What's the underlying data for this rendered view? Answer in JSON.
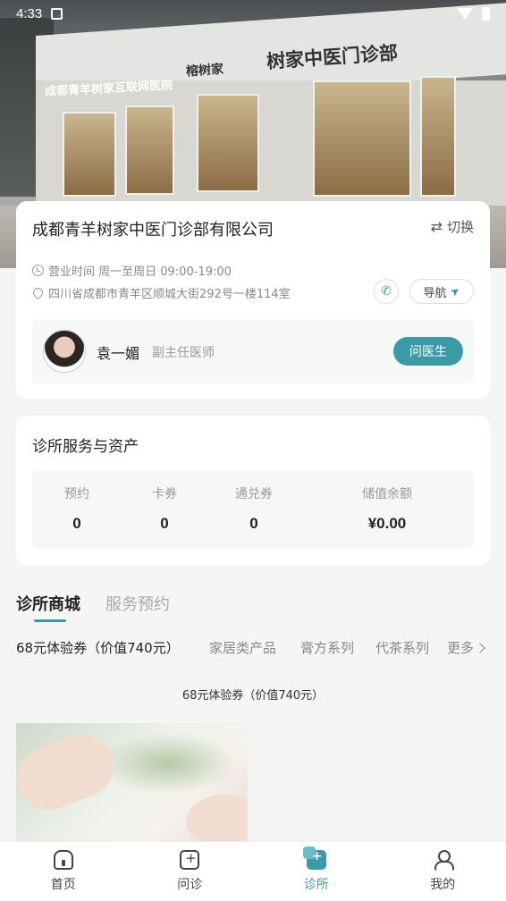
{
  "status_bar": {
    "time": "4:33"
  },
  "hero": {
    "signs": [
      "成都青羊树家互联网医院",
      "树家中医门诊部",
      "榕树家"
    ]
  },
  "clinic": {
    "name": "成都青羊树家中医门诊部有限公司",
    "switch_label": "切换",
    "hours": "营业时间 周一至周日 09:00-19:00",
    "address": "四川省成都市青羊区顺城大街292号一楼114室",
    "nav_label": "导航",
    "doctor": {
      "name": "袁一媚",
      "title": "副主任医师",
      "ask_label": "问医生"
    }
  },
  "assets": {
    "title": "诊所服务与资产",
    "items": [
      {
        "label": "预约",
        "value": "0"
      },
      {
        "label": "卡券",
        "value": "0"
      },
      {
        "label": "通兑券",
        "value": "0"
      },
      {
        "label": "储值余额",
        "value": "¥0.00"
      }
    ]
  },
  "tabs": {
    "mall": "诊所商城",
    "booking": "服务预约"
  },
  "categories": {
    "items": [
      "68元体验券（价值740元）",
      "家居类产品",
      "膏方系列",
      "代茶系列"
    ],
    "more": "更多"
  },
  "section": {
    "title": "68元体验券（价值740元）"
  },
  "bottom_nav": {
    "items": [
      {
        "label": "首页",
        "icon": "home-icon"
      },
      {
        "label": "问诊",
        "icon": "consult-icon"
      },
      {
        "label": "诊所",
        "icon": "clinic-icon"
      },
      {
        "label": "我的",
        "icon": "profile-icon"
      }
    ]
  },
  "colors": {
    "accent": "#3a9aa8"
  }
}
